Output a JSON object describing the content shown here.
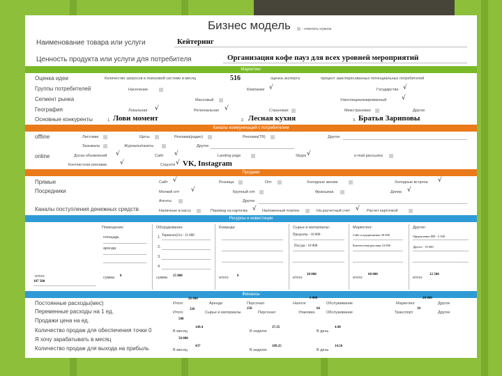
{
  "title": "Бизнес модель",
  "title_note": "- отметить нужное",
  "rows": {
    "product_label": "Наименование товара или услуги",
    "product_value": "Кейтеринг",
    "value_label": "Ценность продукта или услуги для потребителя",
    "value_value": "Организация кофе пауз для всех уровней мероприятий"
  },
  "bands": {
    "marketing": "Маркетинг",
    "channels": "Каналы коммуникаций с потребителем",
    "sales": "Продажи",
    "resources": "Ресурсы и инвестиции",
    "finance": "Финансы"
  },
  "marketing": {
    "idea_label": "Оценка идеи",
    "idea_note": "Количество запросов в поисковой системе в месяц",
    "idea_value": "516",
    "expert": "оценка эксперта",
    "percent": "процент заинтересованных потенциальных потребителей",
    "groups_label": "Группы потребителей",
    "groups_opts": [
      "Население",
      "Компании",
      "Государство"
    ],
    "segment_label": "Сегмент рынка",
    "segment_opts": [
      "Массовый",
      "Узкоспециализированный"
    ],
    "geo_label": "География",
    "geo_opts": [
      "Локальная",
      "Региональная",
      "Страновая",
      "Межстрановая",
      "Другое"
    ],
    "comp_label": "Основные конкуренты",
    "comp": [
      "1.",
      "Лови момент",
      "2.",
      "Лесная кухня",
      "3.",
      "Братья Зариповы"
    ]
  },
  "channels": {
    "offline": "offline",
    "off_opts": [
      "Листовки",
      "Щиты",
      "Реклама(радио)",
      "Реклама(ТВ)",
      "Другое",
      "Зазывала",
      "Журналы/газеты",
      "Другое"
    ],
    "online": "online",
    "on_opts": [
      "Доска объявлений",
      "Сайт",
      "Landing page",
      "Skype",
      "e-mail рассылка",
      "Контекстная реклама",
      "Соцсети"
    ],
    "social_value": "VK, Instagram"
  },
  "sales": {
    "direct": "Прямые",
    "direct_opts": [
      "Сайт",
      "Розница",
      "Опт",
      "Холодные звонки",
      "Холодные встречи"
    ],
    "agents": "Посредники",
    "agent_opts": [
      "Мелкий опт",
      "Крупный опт",
      "Франшиза",
      "Дилер",
      "Агенты",
      "Другое"
    ],
    "money": "Каналы поступления денежных средств",
    "money_opts": [
      "Наличные в кассу",
      "Перевод на карточку",
      "Наложенный платеж",
      "На расчетный счет",
      "Расчет карточкой"
    ]
  },
  "resources": {
    "cols": [
      "Помещение:",
      "Оборудование:",
      "Команда:",
      "Сырье и материалы:",
      "Маркетинг:",
      "Другое:"
    ],
    "room": [
      "площадь",
      "аренда",
      "сумма"
    ],
    "equipment_item": "Термопот(2х) - 15 000",
    "equip_nums": [
      "1.",
      "2.",
      "3.",
      "4."
    ],
    "supplies": [
      "Продукты - 10 000",
      "Посуда - 10 000"
    ],
    "marketing_items": [
      "Сайт и продвижение 30 000",
      "Контекстная реклама 10 000"
    ],
    "other_items": [
      "Оформление ИП - 2 500",
      "Другое - 10 000"
    ],
    "totals_label": "итого",
    "sum_label": "сумма",
    "total_left": "107 500",
    "room_sum": "0",
    "equip_total": "15 000",
    "team_total": "0",
    "supplies_total": "20 000",
    "marketing_total": "60 000",
    "other_total": "12 500"
  },
  "finance": {
    "fixed_label": "Постоянные расходы(мес)",
    "fixed_total": "26 000",
    "fixed_items": [
      "Аренда",
      "Персонал",
      "Налоги",
      "Обслуживание",
      "Маркетинг",
      "Другое"
    ],
    "tax": "6 000",
    "marketing": "20 000",
    "var_label": "Переменные расходы на 1 ед.",
    "var_total": "326",
    "raw": "250",
    "var_items": [
      "Сырье и материалы",
      "Персонал",
      "Упаковка",
      "Обслуживание",
      "Транспорт",
      "Другое"
    ],
    "pack": "66",
    "transport": "10",
    "price_label": "Продажи цена на ед.",
    "price": "500",
    "qty_label": "Количество продаж для обеспечения точки 0",
    "qty_month": "149.4",
    "qty_week": "37.35",
    "qty_day": "4.98",
    "want_label": "Я хочу зарабатывать в месяц",
    "want": "50 000",
    "profit_label": "Количество продаж для выхода на прибыль",
    "pm": "437",
    "pw": "109.25",
    "pd": "14.56",
    "month": "В месяц",
    "week": "В неделю",
    "day": "В день",
    "total": "Итого"
  }
}
